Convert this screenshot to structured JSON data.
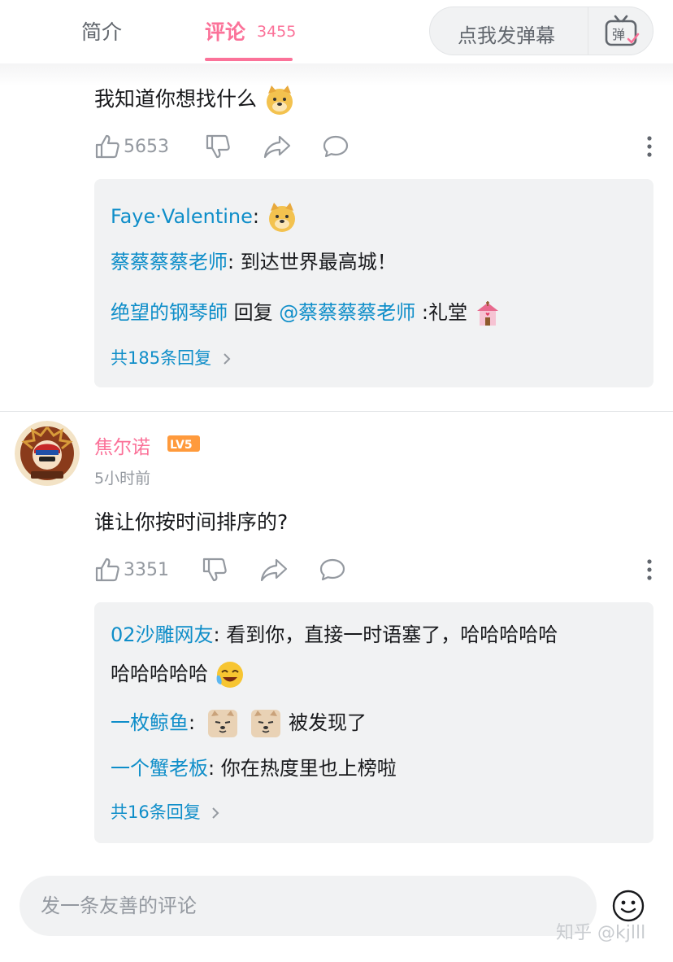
{
  "tabs": {
    "intro_label": "简介",
    "comments_label": "评论",
    "comments_count": "3455"
  },
  "danmaku": {
    "placeholder": "点我发弹幕",
    "icon_label": "弹"
  },
  "comment1": {
    "text": "我知道你想找什么",
    "likes": "5653",
    "replies": [
      {
        "user": "Faye·Valentine",
        "sep": ":",
        "text": ""
      },
      {
        "user": "蔡蔡蔡蔡老师",
        "sep": ":",
        "text": " 到达世界最高城！"
      },
      {
        "user": "绝望的钢琴師",
        "mid": " 回复 ",
        "target": "@蔡蔡蔡蔡老师",
        "text": " :礼堂"
      }
    ],
    "more_replies": "共185条回复"
  },
  "comment2": {
    "author": "焦尔诺",
    "level": "LV5",
    "time": "5小时前",
    "text": "谁让你按时间排序的?",
    "likes": "3351",
    "replies": [
      {
        "user": "02沙雕网友",
        "sep": ":",
        "text": " 看到你，直接一时语塞了，哈哈哈哈哈",
        "text2": "哈哈哈哈哈"
      },
      {
        "user": "一枚鲸鱼",
        "sep": ":",
        "text": "被发现了"
      },
      {
        "user": "一个蟹老板",
        "sep": ":",
        "text": " 你在热度里也上榜啦"
      }
    ],
    "more_replies": "共16条回复"
  },
  "input": {
    "placeholder": "发一条友善的评论"
  },
  "watermark": "知乎 @kjlll",
  "colors": {
    "accent": "#fb7299",
    "link": "#0f8ec9",
    "muted": "#9499a0",
    "reply_bg": "#f1f2f3"
  },
  "icons": [
    "thumbs-up-icon",
    "thumbs-down-icon",
    "share-icon",
    "reply-icon",
    "more-icon",
    "emoji-icon",
    "danmaku-icon"
  ]
}
